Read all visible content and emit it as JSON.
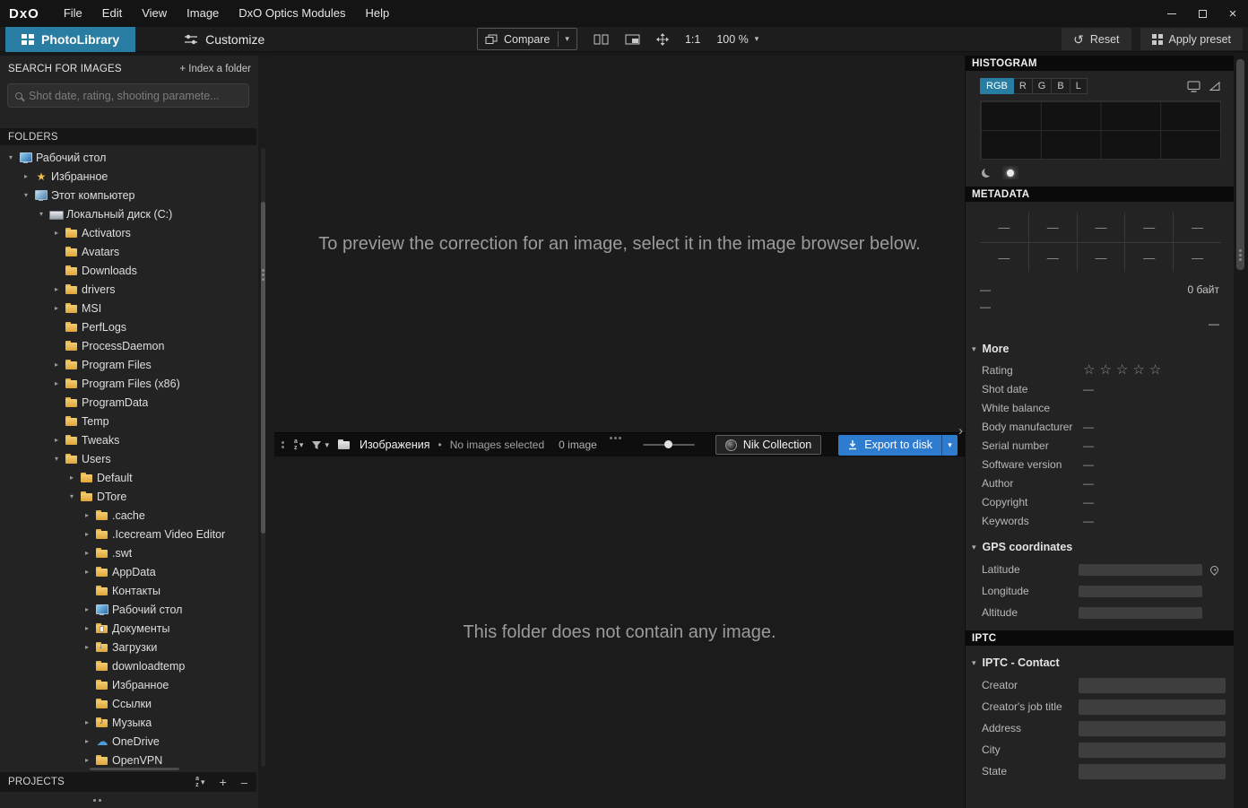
{
  "glyphs": {
    "caret": "▾",
    "arrow_right": "▸",
    "arrow_down": "▾",
    "bullet": "•",
    "chevron": "›",
    "close": "×",
    "star": "☆",
    "star_filled": "★",
    "cloud": "☁",
    "reset": "↺",
    "plus": "+",
    "minus": "–",
    "down": "↓",
    "music": "♪",
    "sort_letters": [
      "a",
      "z"
    ]
  },
  "titlebar": {
    "logo": "DxO",
    "menus": [
      "File",
      "Edit",
      "View",
      "Image",
      "DxO Optics Modules",
      "Help"
    ]
  },
  "tabs": {
    "photolibrary": "PhotoLibrary",
    "customize": "Customize"
  },
  "toolbar": {
    "compare": "Compare",
    "ratio": "1:1",
    "zoom": "100 %",
    "reset": "Reset",
    "apply_preset": "Apply preset"
  },
  "left": {
    "search_title": "SEARCH FOR IMAGES",
    "index_folder": "+ Index a folder",
    "search_placeholder": "Shot date, rating, shooting paramete...",
    "folders_title": "FOLDERS",
    "projects_title": "PROJECTS",
    "tree": [
      {
        "label": "Рабочий стол",
        "level": 0,
        "icon": "desktop",
        "arrow": "down"
      },
      {
        "label": "Избранное",
        "level": 1,
        "icon": "star",
        "arrow": "right"
      },
      {
        "label": "Этот компьютер",
        "level": 1,
        "icon": "computer",
        "arrow": "down"
      },
      {
        "label": "Локальный диск (C:)",
        "level": 2,
        "icon": "disk",
        "arrow": "down"
      },
      {
        "label": "Activators",
        "level": 3,
        "icon": "folder",
        "arrow": "right"
      },
      {
        "label": "Avatars",
        "level": 3,
        "icon": "folder",
        "arrow": "none"
      },
      {
        "label": "Downloads",
        "level": 3,
        "icon": "folder",
        "arrow": "none"
      },
      {
        "label": "drivers",
        "level": 3,
        "icon": "folder",
        "arrow": "right"
      },
      {
        "label": "MSI",
        "level": 3,
        "icon": "folder",
        "arrow": "right"
      },
      {
        "label": "PerfLogs",
        "level": 3,
        "icon": "folder",
        "arrow": "none"
      },
      {
        "label": "ProcessDaemon",
        "level": 3,
        "icon": "folder",
        "arrow": "none"
      },
      {
        "label": "Program Files",
        "level": 3,
        "icon": "folder",
        "arrow": "right"
      },
      {
        "label": "Program Files (x86)",
        "level": 3,
        "icon": "folder",
        "arrow": "right"
      },
      {
        "label": "ProgramData",
        "level": 3,
        "icon": "folder",
        "arrow": "none"
      },
      {
        "label": "Temp",
        "level": 3,
        "icon": "folder",
        "arrow": "none"
      },
      {
        "label": "Tweaks",
        "level": 3,
        "icon": "folder",
        "arrow": "right"
      },
      {
        "label": "Users",
        "level": 3,
        "icon": "folder",
        "arrow": "down"
      },
      {
        "label": "Default",
        "level": 4,
        "icon": "folder",
        "arrow": "right"
      },
      {
        "label": "DTore",
        "level": 4,
        "icon": "folder",
        "arrow": "down"
      },
      {
        "label": ".cache",
        "level": 5,
        "icon": "folder",
        "arrow": "right"
      },
      {
        "label": ".Icecream Video Editor",
        "level": 5,
        "icon": "folder",
        "arrow": "right"
      },
      {
        "label": ".swt",
        "level": 5,
        "icon": "folder",
        "arrow": "right"
      },
      {
        "label": "AppData",
        "level": 5,
        "icon": "folder",
        "arrow": "right"
      },
      {
        "label": "Контакты",
        "level": 5,
        "icon": "folder",
        "arrow": "none"
      },
      {
        "label": "Рабочий стол",
        "level": 5,
        "icon": "desktop",
        "arrow": "right"
      },
      {
        "label": "Документы",
        "level": 5,
        "icon": "docs",
        "arrow": "right"
      },
      {
        "label": "Загрузки",
        "level": 5,
        "icon": "downloads",
        "arrow": "right"
      },
      {
        "label": "downloadtemp",
        "level": 5,
        "icon": "folder",
        "arrow": "none"
      },
      {
        "label": "Избранное",
        "level": 5,
        "icon": "folder",
        "arrow": "none"
      },
      {
        "label": "Ссылки",
        "level": 5,
        "icon": "folder",
        "arrow": "none"
      },
      {
        "label": "Музыка",
        "level": 5,
        "icon": "music",
        "arrow": "right"
      },
      {
        "label": "OneDrive",
        "level": 5,
        "icon": "onedrive",
        "arrow": "right"
      },
      {
        "label": "OpenVPN",
        "level": 5,
        "icon": "folder",
        "arrow": "right"
      }
    ]
  },
  "center": {
    "preview_message": "To preview the correction for an image, select it in the image browser below.",
    "empty_message": "This folder does not contain any image.",
    "filmstrip": {
      "folder_name": "Изображения",
      "selection": "No images selected",
      "count": "0 image",
      "nik": "Nik Collection",
      "export": "Export to disk"
    }
  },
  "right": {
    "histogram": {
      "title": "HISTOGRAM",
      "channels": [
        "RGB",
        "R",
        "G",
        "B",
        "L"
      ],
      "active_channel": "RGB"
    },
    "metadata": {
      "title": "METADATA",
      "placeholder": "—",
      "lines": [
        {
          "left": "—",
          "right": "0 байт"
        },
        {
          "left": "—",
          "right": ""
        },
        {
          "left": "",
          "right": "—"
        }
      ]
    },
    "more": {
      "title": "More",
      "rows": [
        {
          "label": "Rating",
          "value": "",
          "stars": true
        },
        {
          "label": "Shot date",
          "value": "—"
        },
        {
          "label": "White balance",
          "value": ""
        },
        {
          "label": "Body manufacturer",
          "value": "—"
        },
        {
          "label": "Serial number",
          "value": "—"
        },
        {
          "label": "Software version",
          "value": "—"
        },
        {
          "label": "Author",
          "value": "—"
        },
        {
          "label": "Copyright",
          "value": "—"
        },
        {
          "label": "Keywords",
          "value": "—"
        }
      ]
    },
    "gps": {
      "title": "GPS coordinates",
      "rows": [
        "Latitude",
        "Longitude",
        "Altitude"
      ]
    },
    "iptc": {
      "title": "IPTC",
      "contact": "IPTC - Contact",
      "rows": [
        "Creator",
        "Creator's job title",
        "Address",
        "City",
        "State"
      ]
    }
  },
  "colors": {
    "accent": "#2a7da2",
    "export_blue": "#2e7cd0",
    "folder": "#eab948"
  }
}
